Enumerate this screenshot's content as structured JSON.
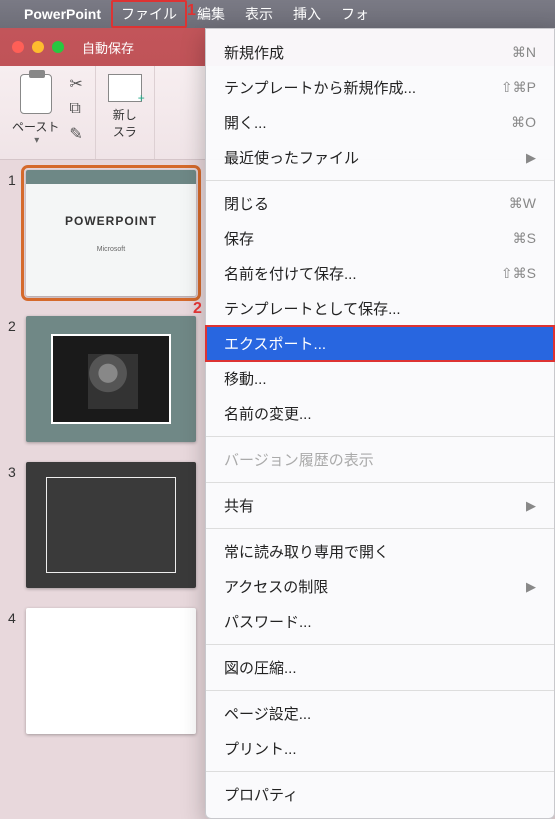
{
  "menubar": {
    "app_name": "PowerPoint",
    "items": [
      "ファイル",
      "編集",
      "表示",
      "挿入",
      "フォ"
    ]
  },
  "titlebar": {
    "autosave": "自動保存"
  },
  "ribbon": {
    "paste": "ペースト",
    "newslide": "新し\nスラ"
  },
  "thumbs": {
    "t1": {
      "title": "POWERPOINT",
      "sub": "Microsoft"
    }
  },
  "dropdown": [
    {
      "label": "新規作成",
      "shortcut": "⌘N",
      "type": "item"
    },
    {
      "label": "テンプレートから新規作成...",
      "shortcut": "⇧⌘P",
      "type": "item"
    },
    {
      "label": "開く...",
      "shortcut": "⌘O",
      "type": "item"
    },
    {
      "label": "最近使ったファイル",
      "shortcut": "▶",
      "type": "submenu"
    },
    {
      "type": "sep"
    },
    {
      "label": "閉じる",
      "shortcut": "⌘W",
      "type": "item"
    },
    {
      "label": "保存",
      "shortcut": "⌘S",
      "type": "item"
    },
    {
      "label": "名前を付けて保存...",
      "shortcut": "⇧⌘S",
      "type": "item"
    },
    {
      "label": "テンプレートとして保存...",
      "shortcut": "",
      "type": "item"
    },
    {
      "label": "エクスポート...",
      "shortcut": "",
      "type": "item",
      "highlight": true
    },
    {
      "label": "移動...",
      "shortcut": "",
      "type": "item"
    },
    {
      "label": "名前の変更...",
      "shortcut": "",
      "type": "item"
    },
    {
      "type": "sep"
    },
    {
      "label": "バージョン履歴の表示",
      "shortcut": "",
      "type": "item",
      "disabled": true
    },
    {
      "type": "sep"
    },
    {
      "label": "共有",
      "shortcut": "▶",
      "type": "submenu"
    },
    {
      "type": "sep"
    },
    {
      "label": "常に読み取り専用で開く",
      "shortcut": "",
      "type": "item"
    },
    {
      "label": "アクセスの制限",
      "shortcut": "▶",
      "type": "submenu"
    },
    {
      "label": "パスワード...",
      "shortcut": "",
      "type": "item"
    },
    {
      "type": "sep"
    },
    {
      "label": "図の圧縮...",
      "shortcut": "",
      "type": "item"
    },
    {
      "type": "sep"
    },
    {
      "label": "ページ設定...",
      "shortcut": "",
      "type": "item"
    },
    {
      "label": "プリント...",
      "shortcut": "",
      "type": "item"
    },
    {
      "type": "sep"
    },
    {
      "label": "プロパティ",
      "shortcut": "",
      "type": "item"
    }
  ],
  "annotations": {
    "a1": "1",
    "a2": "2"
  }
}
